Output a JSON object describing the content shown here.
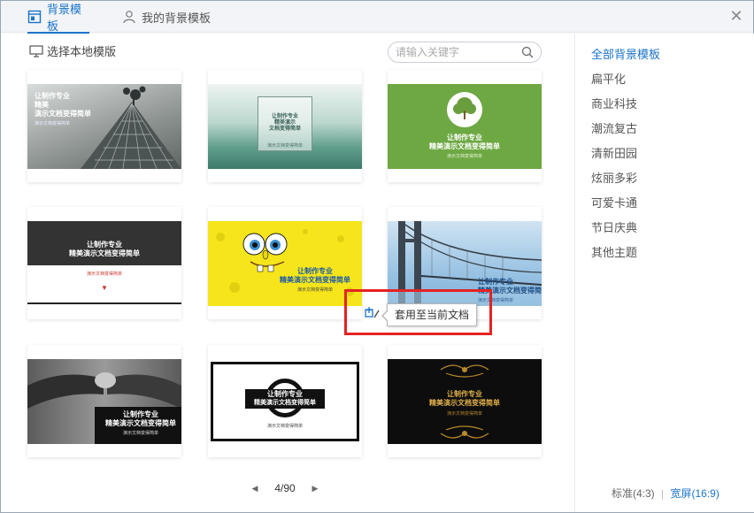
{
  "tabs": [
    {
      "label": "背景模板",
      "active": true,
      "icon": "template-icon"
    },
    {
      "label": "我的背景模板",
      "active": false,
      "icon": "user-icon"
    }
  ],
  "toolbar": {
    "local_label": "选择本地模版",
    "search_placeholder": "请输入关键字"
  },
  "templates": [
    {
      "name": "template-1",
      "lines": [
        "让制作专业",
        "精美",
        "演示文档变得简单"
      ],
      "sub": "演示文档变得简单"
    },
    {
      "name": "template-2",
      "lines": [
        "让制作专业",
        "精美演示",
        "文档变得简单"
      ],
      "sub": "演示文档变得简单"
    },
    {
      "name": "template-3",
      "lines": [
        "让制作专业",
        "精美演示文档变得简单"
      ],
      "sub": "演示文档变得简单"
    },
    {
      "name": "template-4",
      "lines": [
        "让制作专业",
        "精美演示文档变得简单"
      ],
      "sub": "演示文档变得简单"
    },
    {
      "name": "template-5",
      "lines": [
        "让制作专业",
        "精美演示文档变得简单"
      ],
      "sub": "演示文档变得简单"
    },
    {
      "name": "template-6",
      "lines": [
        "让制作专业",
        "精美演示文档变得简单"
      ],
      "sub": "演示文档变得简单"
    },
    {
      "name": "template-7",
      "lines": [
        "让制作专业",
        "精美演示文档变得简单"
      ],
      "sub": "演示文档变得简单"
    },
    {
      "name": "template-8",
      "lines": [
        "让制作专业",
        "精美演示文档变得简单"
      ],
      "sub": "演示文档变得简单"
    },
    {
      "name": "template-9",
      "lines": [
        "让制作专业",
        "精美演示文档变得简单"
      ],
      "sub": "演示文档变得简单"
    }
  ],
  "tooltip": {
    "label": "套用至当前文档",
    "icon": "apply-template-icon"
  },
  "pager": {
    "current": "4/90"
  },
  "categories": [
    {
      "label": "全部背景模板",
      "active": true
    },
    {
      "label": "扁平化"
    },
    {
      "label": "商业科技"
    },
    {
      "label": "潮流复古"
    },
    {
      "label": "清新田园"
    },
    {
      "label": "炫丽多彩"
    },
    {
      "label": "可爱卡通"
    },
    {
      "label": "节日庆典"
    },
    {
      "label": "其他主题"
    }
  ],
  "ratio": {
    "standard": "标准(4:3)",
    "separator": "|",
    "wide": "宽屏(16:9)",
    "selected": "wide"
  },
  "colors": {
    "accent": "#1a73c9",
    "highlight": "#e52222"
  }
}
